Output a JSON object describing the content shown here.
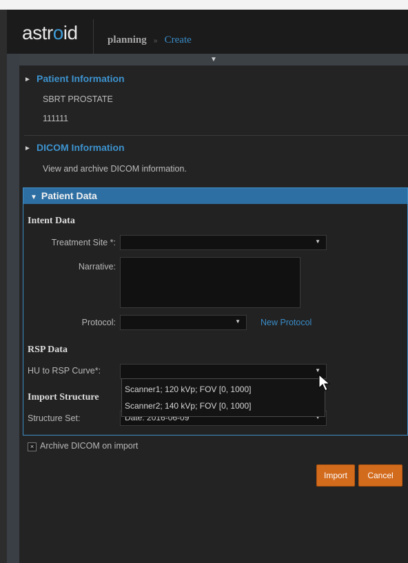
{
  "app": {
    "logo_prefix": "astr",
    "logo_highlight": "o",
    "logo_suffix": "id"
  },
  "breadcrumb": {
    "section": "planning",
    "separator": "»",
    "page": "Create"
  },
  "collapse_toggle": "▼",
  "patient_info": {
    "title": "Patient Information",
    "name": "SBRT PROSTATE",
    "id": "111111"
  },
  "dicom_info": {
    "title": "DICOM Information",
    "description": "View and archive DICOM information."
  },
  "patient_data": {
    "title": "Patient Data",
    "intent": {
      "heading": "Intent Data",
      "treatment_site_label": "Treatment Site *:",
      "treatment_site_value": "",
      "narrative_label": "Narrative:",
      "narrative_value": "",
      "protocol_label": "Protocol:",
      "protocol_value": "",
      "new_protocol_link": "New Protocol"
    },
    "rsp": {
      "heading": "RSP Data",
      "curve_label": "HU to RSP Curve*:",
      "curve_value": "",
      "options": [
        "Scanner1; 120 kVp; FOV [0, 1000]",
        "Scanner2; 140 kVp; FOV [0, 1000]"
      ]
    },
    "structure": {
      "heading": "Import Structure",
      "set_label": "Structure Set:",
      "set_value": "Date: 2016-06-09"
    }
  },
  "archive": {
    "checked": true,
    "check_glyph": "×",
    "label": "Archive DICOM on import"
  },
  "buttons": {
    "import": "Import",
    "cancel": "Cancel",
    "color": "#d36b1d"
  },
  "colors": {
    "accent": "#3d93cf",
    "header_bar": "#2e6fa3"
  }
}
